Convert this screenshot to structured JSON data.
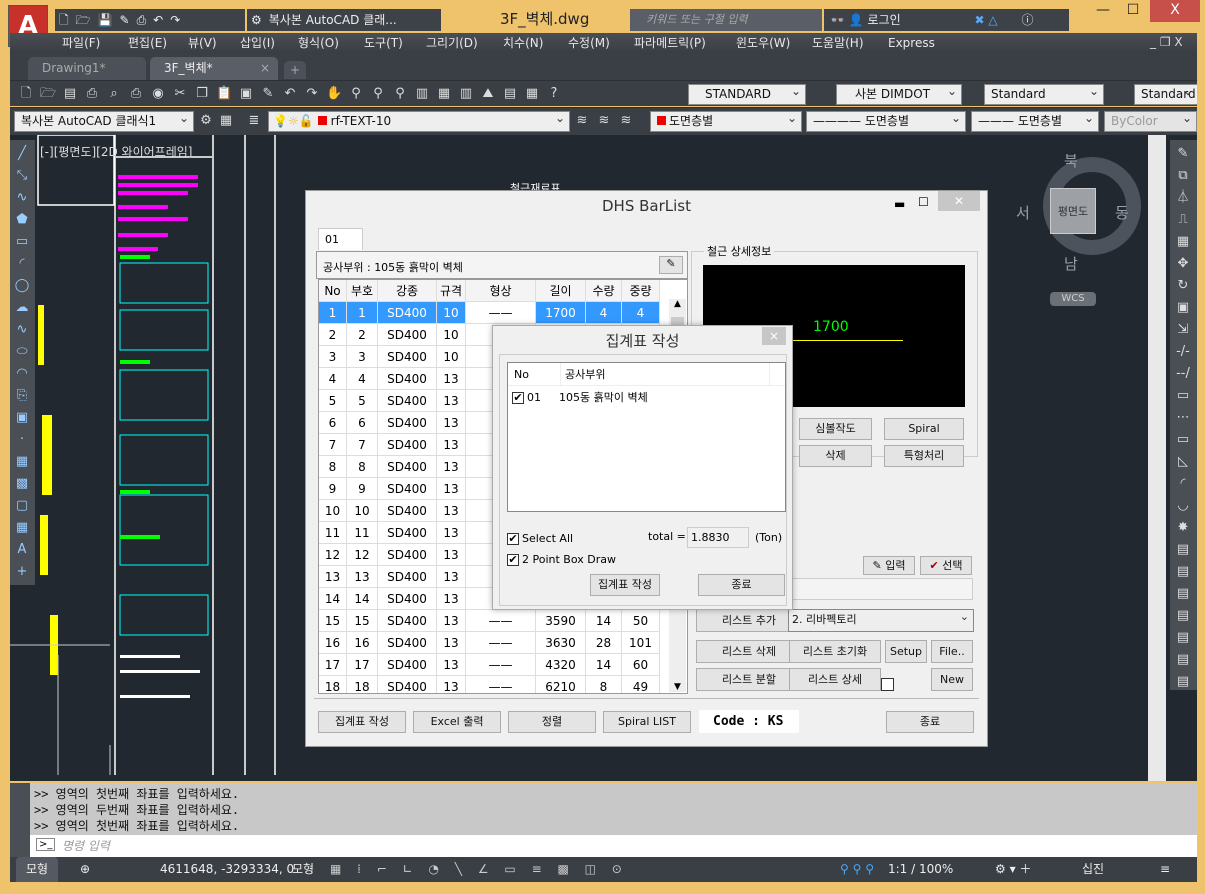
{
  "app": {
    "document_title": "3F_벽체.dwg",
    "workspace": "복사본 AutoCAD 클래...",
    "search_placeholder": "키워드 또는 구절 입력",
    "login": "로그인",
    "minimize": "—",
    "maximize": "☐",
    "close": "X"
  },
  "menu": [
    "파일(F)",
    "편집(E)",
    "뷰(V)",
    "삽입(I)",
    "형식(O)",
    "도구(T)",
    "그리기(D)",
    "치수(N)",
    "수정(M)",
    "파라메트릭(P)",
    "윈도우(W)",
    "도움말(H)",
    "Express"
  ],
  "doc_tabs": [
    {
      "label": "Drawing1*"
    },
    {
      "label": "3F_벽체*",
      "close": "×"
    }
  ],
  "toolbar1": {
    "text_style": "STANDARD",
    "dim_style": "사본 DIMDOT",
    "table_style": "Standard",
    "mleader_style": "Standard"
  },
  "toolbar2": {
    "workspace": "복사본 AutoCAD 클래식1",
    "layer": "rf-TEXT-10",
    "color": "도면층별",
    "linetype": "도면층별",
    "lineweight": "도면층별",
    "plot_style": "ByColor"
  },
  "accent_colors": {
    "title_bar": "#efc36c",
    "selection": "#3399ff",
    "canvas": "#212830"
  },
  "viewport": {
    "label": "[-][평면도][2D 와이어프레임]",
    "drawing_title": "철근재료표"
  },
  "viewcube": {
    "north": "북",
    "south": "남",
    "east": "동",
    "west": "서",
    "face": "평면도",
    "ucs": "WCS"
  },
  "command": {
    "history": [
      ">> 영역의 첫번째 좌표를 입력하세요.",
      ">> 영역의 두번째 좌표를 입력하세요.",
      ">> 영역의 첫번째 좌표를 입력하세요."
    ],
    "placeholder": "명령 입력"
  },
  "status": {
    "model_tab": "모형",
    "coords": "4611648, -3293334, 0",
    "model": "모형",
    "scale": "1:1 / 100%",
    "units": "십진"
  },
  "barlist": {
    "title": "DHS BarList",
    "tab": "01",
    "site_label": "공사부위 :",
    "site_value": "105동 흙막이 벽체",
    "columns": [
      "No",
      "부호",
      "강종",
      "규격",
      "형상",
      "길이",
      "수량",
      "중량"
    ],
    "rows": [
      [
        "1",
        "1",
        "SD400",
        "10",
        "——",
        "1700",
        "4",
        "4"
      ],
      [
        "2",
        "2",
        "SD400",
        "10",
        "",
        "",
        "",
        ""
      ],
      [
        "3",
        "3",
        "SD400",
        "10",
        "",
        "",
        "",
        ""
      ],
      [
        "4",
        "4",
        "SD400",
        "13",
        "",
        "",
        "",
        ""
      ],
      [
        "5",
        "5",
        "SD400",
        "13",
        "",
        "",
        "",
        ""
      ],
      [
        "6",
        "6",
        "SD400",
        "13",
        "",
        "",
        "",
        ""
      ],
      [
        "7",
        "7",
        "SD400",
        "13",
        "",
        "",
        "",
        ""
      ],
      [
        "8",
        "8",
        "SD400",
        "13",
        "",
        "",
        "",
        ""
      ],
      [
        "9",
        "9",
        "SD400",
        "13",
        "",
        "",
        "",
        ""
      ],
      [
        "10",
        "10",
        "SD400",
        "13",
        "",
        "",
        "",
        ""
      ],
      [
        "11",
        "11",
        "SD400",
        "13",
        "",
        "",
        "",
        ""
      ],
      [
        "12",
        "12",
        "SD400",
        "13",
        "",
        "",
        "",
        ""
      ],
      [
        "13",
        "13",
        "SD400",
        "13",
        "",
        "",
        "",
        ""
      ],
      [
        "14",
        "14",
        "SD400",
        "13",
        "",
        "",
        "",
        ""
      ],
      [
        "15",
        "15",
        "SD400",
        "13",
        "——",
        "3590",
        "14",
        "50"
      ],
      [
        "16",
        "16",
        "SD400",
        "13",
        "——",
        "3630",
        "28",
        "101"
      ],
      [
        "17",
        "17",
        "SD400",
        "13",
        "——",
        "4320",
        "14",
        "60"
      ],
      [
        "18",
        "18",
        "SD400",
        "13",
        "——",
        "6210",
        "8",
        "49"
      ]
    ],
    "detail_group": "철근 상세정보",
    "preview_length": "1700",
    "buttons": {
      "symbol": "심볼작도",
      "spiral": "Spiral",
      "delete": "삭제",
      "special": "특형처리",
      "input": "입력",
      "select": "선택",
      "list_add": "리스트 추가",
      "list_delete": "리스트 삭제",
      "list_reset": "리스트 초기화",
      "setup": "Setup",
      "file": "File..",
      "list_split": "리스트 분할",
      "list_detail": "리스트 상세",
      "new": "New",
      "summary": "집계표 작성",
      "excel": "Excel 출력",
      "sort": "정렬",
      "spiral_list": "Spiral LIST",
      "close": "종료"
    },
    "list_select": "2. 리바펙토리",
    "code": "Code : KS"
  },
  "summary_dialog": {
    "title": "집계표 작성",
    "close": "×",
    "columns": [
      "No",
      "공사부위"
    ],
    "items": [
      {
        "checked": true,
        "no": "01",
        "site": "105동 흙막이 벽체"
      }
    ],
    "select_all": "Select All",
    "two_point": "2 Point Box Draw",
    "total_label": "total =",
    "total_value": "1.8830",
    "unit": "(Ton)",
    "create": "집계표 작성",
    "close_button": "종료"
  }
}
